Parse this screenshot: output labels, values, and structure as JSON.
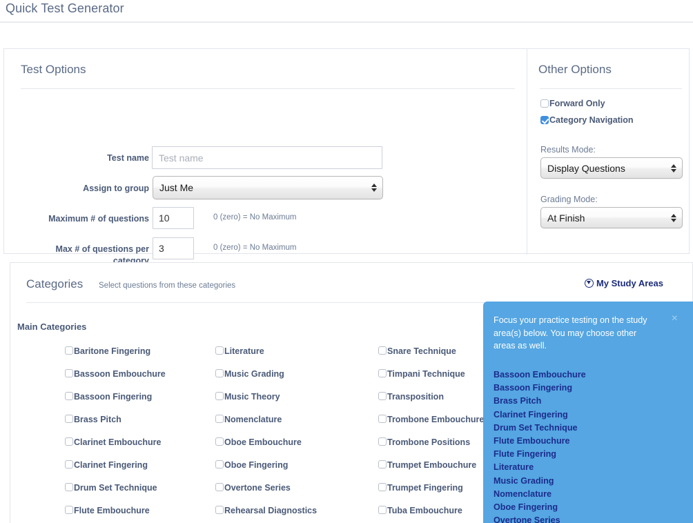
{
  "header": {
    "title": "Quick Test Generator"
  },
  "test_options": {
    "panel_title": "Test Options",
    "test_name_label": "Test name",
    "test_name_value": "",
    "test_name_placeholder": "Test name",
    "assign_group_label": "Assign to group",
    "assign_group_value": "Just Me",
    "assign_group_options": [
      "Just Me"
    ],
    "max_questions_label": "Maximum # of questions",
    "max_questions_value": "10",
    "max_questions_hint": "0 (zero) = No Maximum",
    "max_per_category_label": "Max # of questions per category",
    "max_per_category_value": "3",
    "max_per_category_hint": "0 (zero) = No Maximum"
  },
  "other_options": {
    "panel_title": "Other Options",
    "forward_only_label": "Forward Only",
    "forward_only_checked": false,
    "category_navigation_label": "Category Navigation",
    "category_navigation_checked": true,
    "results_mode_label": "Results Mode:",
    "results_mode_value": "Display Questions",
    "results_mode_options": [
      "Display Questions"
    ],
    "grading_mode_label": "Grading Mode:",
    "grading_mode_value": "At Finish",
    "grading_mode_options": [
      "At Finish"
    ]
  },
  "categories": {
    "title": "Categories",
    "subtitle": "Select questions from these categories",
    "study_areas_link": "My Study Areas",
    "study_areas_icon": "circle-down-arrow-icon",
    "main_heading": "Main Categories",
    "column1": [
      "Baritone Fingering",
      "Bassoon Embouchure",
      "Bassoon Fingering",
      "Brass Pitch",
      "Clarinet Embouchure",
      "Clarinet Fingering",
      "Drum Set Technique",
      "Flute Embouchure"
    ],
    "column2": [
      "Literature",
      "Music Grading",
      "Music Theory",
      "Nomenclature",
      "Oboe Embouchure",
      "Oboe Fingering",
      "Overtone Series",
      "Rehearsal Diagnostics"
    ],
    "column3": [
      "Snare Technique",
      "Timpani Technique",
      "Transposition",
      "Trombone Embouchure",
      "Trombone Positions",
      "Trumpet Embouchure",
      "Trumpet Fingering",
      "Tuba Embouchure"
    ]
  },
  "popover": {
    "message": "Focus your practice testing on the study area(s) below. You may choose other areas as well.",
    "close_label": "×",
    "background_color": "#55a6e2",
    "items": [
      "Bassoon Embouchure",
      "Bassoon Fingering",
      "Brass Pitch",
      "Clarinet Fingering",
      "Drum Set Technique",
      "Flute Embouchure",
      "Flute Fingering",
      "Literature",
      "Music Grading",
      "Nomenclature",
      "Oboe Fingering",
      "Overtone Series"
    ]
  }
}
